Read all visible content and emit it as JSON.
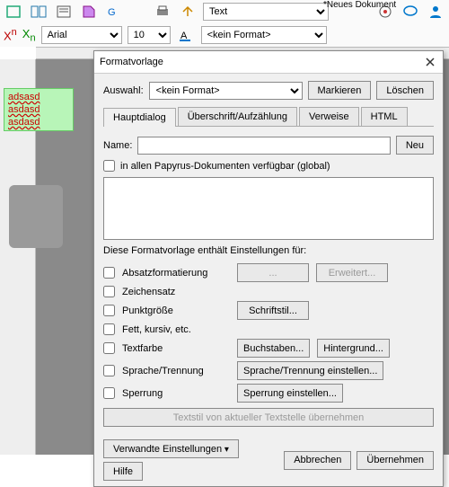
{
  "doc_title": "*Neues Dokument",
  "toolbar": {
    "style_select": "Text",
    "font": "Arial",
    "size": "10",
    "format": "<kein Format>"
  },
  "note_lines": [
    "adsasd",
    "asdasd",
    "asdasd"
  ],
  "dialog": {
    "title": "Formatvorlage",
    "auswahl_label": "Auswahl:",
    "auswahl_value": "<kein Format>",
    "markieren": "Markieren",
    "loeschen": "Löschen",
    "tabs": [
      "Hauptdialog",
      "Überschrift/Aufzählung",
      "Verweise",
      "HTML"
    ],
    "name_label": "Name:",
    "name_value": "",
    "neu": "Neu",
    "global_label": "in allen Papyrus-Dokumenten verfügbar (global)",
    "enth_label": "Diese Formatvorlage enthält Einstellungen für:",
    "opts": {
      "absatz": "Absatzformatierung",
      "zeichen": "Zeichensatz",
      "punkt": "Punktgröße",
      "fett": "Fett, kursiv, etc.",
      "textfarbe": "Textfarbe",
      "sprache": "Sprache/Trennung",
      "sperrung": "Sperrung"
    },
    "btns": {
      "dots": "...",
      "erweitert": "Erweitert...",
      "schriftstil": "Schriftstil...",
      "buchstaben": "Buchstaben...",
      "hintergrund": "Hintergrund...",
      "sprache_btn": "Sprache/Trennung einstellen...",
      "sperrung_btn": "Sperrung einstellen...",
      "textstil": "Textstil von aktueller Textstelle übernehmen"
    },
    "verwandte": "Verwandte Einstellungen",
    "hilfe": "Hilfe",
    "abbrechen": "Abbrechen",
    "uebernehmen": "Übernehmen"
  }
}
